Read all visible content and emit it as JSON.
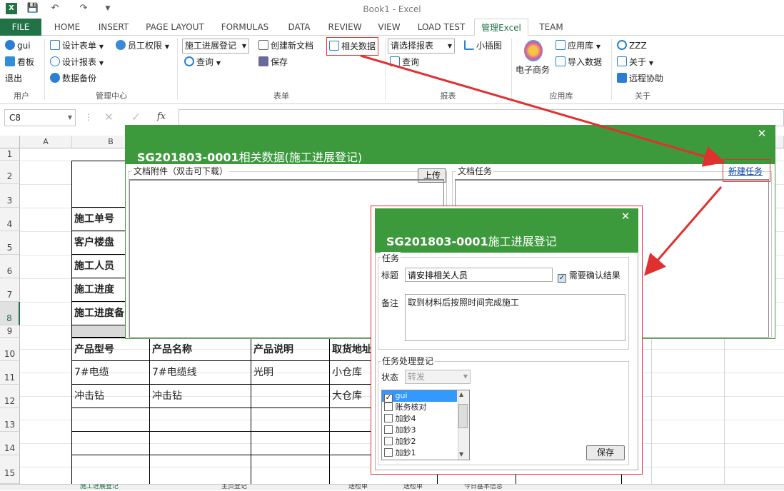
{
  "window": {
    "title": "Book1 - Excel"
  },
  "ribbon_tabs": [
    "FILE",
    "HOME",
    "INSERT",
    "PAGE LAYOUT",
    "FORMULAS",
    "DATA",
    "REVIEW",
    "VIEW",
    "LOAD TEST",
    "管理Excel",
    "TEAM"
  ],
  "ribbon": {
    "user": {
      "name": "gui",
      "dashboard": "看板",
      "logout": "退出",
      "group": "用户"
    },
    "manage": {
      "design_form": "设计表单",
      "staff_perm": "员工权限",
      "design_report": "设计报表",
      "backup": "数据备份",
      "group": "管理中心"
    },
    "form": {
      "form_select": "施工进展登记",
      "query": "查询",
      "new_doc": "创建新文档",
      "save": "保存",
      "related": "相关数据",
      "group": "表单"
    },
    "report": {
      "report_select": "请选择报表",
      "query": "查询",
      "sparkline": "小插图",
      "group": "报表"
    },
    "apps": {
      "ecommerce": "电子商务",
      "app_store": "应用库",
      "import": "导入数据",
      "group": "应用库"
    },
    "about": {
      "zzz": "ZZZ",
      "about": "关于",
      "remote": "远程协助",
      "group": "关于"
    }
  },
  "formula_bar": {
    "name_box": "C8",
    "fx": "fx"
  },
  "grid": {
    "columns": [
      "A",
      "B"
    ],
    "rows": [
      "1",
      "2",
      "3",
      "4",
      "5",
      "6",
      "7",
      "8",
      "9",
      "10",
      "11",
      "12",
      "13",
      "14",
      "15"
    ],
    "labels": [
      "施工单号",
      "客户楼盘",
      "施工人员",
      "施工进度",
      "施工进度备"
    ],
    "table_headers": [
      "产品型号",
      "产品名称",
      "产品说明",
      "取货地址"
    ],
    "table_rows": [
      [
        "7#电缆",
        "7#电缆线",
        "光明",
        "小仓库"
      ],
      [
        "冲击钻",
        "冲击钻",
        "",
        "大仓库"
      ]
    ]
  },
  "sheet_tabs": [
    "施工进展登记",
    "主页登记",
    "送检单",
    "送检单",
    "今日基本信息"
  ],
  "dialog_related": {
    "title_code": "SG201803-0001",
    "title_text": "相关数据(施工进展登记)",
    "attachments_label": "文档附件（双击可下载）",
    "upload": "上传",
    "tasks_label": "文档任务",
    "new_task": "新建任务"
  },
  "dialog_task": {
    "title_code": "SG201803-0001",
    "title_text": "施工进展登记",
    "section_task": "任务",
    "subject_label": "标题",
    "subject_value": "请安排相关人员",
    "need_confirm": "需要确认结果",
    "note_label": "备注",
    "note_value": "取到材料后按照时间完成施工",
    "section_process": "任务处理登记",
    "status_label": "状态",
    "status_value": "转发",
    "assignees": [
      {
        "name": "gui",
        "checked": true
      },
      {
        "name": "账务核对",
        "checked": false
      },
      {
        "name": "加鈔4",
        "checked": false
      },
      {
        "name": "加鈔3",
        "checked": false
      },
      {
        "name": "加鈔2",
        "checked": false
      },
      {
        "name": "加鈔1",
        "checked": false
      }
    ],
    "save": "保存"
  },
  "colors": {
    "excel_green": "#217346",
    "dialog_green": "#3c9a3c",
    "highlight_red": "#e03030"
  }
}
